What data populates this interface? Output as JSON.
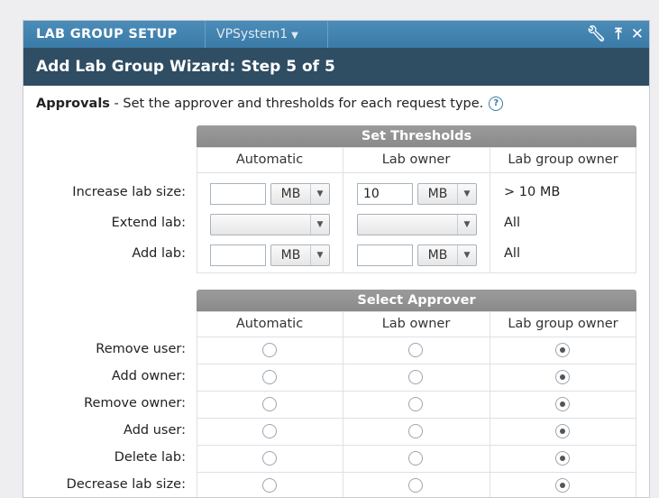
{
  "tabs": {
    "active": "LAB GROUP SETUP",
    "system": "VPSystem1"
  },
  "wizard": {
    "title": "Add Lab Group Wizard: Step 5 of 5"
  },
  "approvals": {
    "label": "Approvals",
    "text": " - Set the approver and thresholds for each request type."
  },
  "thresholds": {
    "title": "Set Thresholds",
    "columns": [
      "Automatic",
      "Lab owner",
      "Lab group owner"
    ],
    "rows": [
      {
        "label": "Increase lab size:",
        "auto_value": "",
        "auto_unit": "MB",
        "owner_value": "10",
        "owner_unit": "MB",
        "group": "> 10 MB"
      },
      {
        "label": "Extend lab:",
        "auto_value": "",
        "auto_unit": "",
        "owner_value": "",
        "owner_unit": "",
        "group": "All"
      },
      {
        "label": "Add lab:",
        "auto_value": "",
        "auto_unit": "MB",
        "owner_value": "",
        "owner_unit": "MB",
        "group": "All"
      }
    ]
  },
  "approver": {
    "title": "Select Approver",
    "columns": [
      "Automatic",
      "Lab owner",
      "Lab group owner"
    ],
    "rows": [
      {
        "label": "Remove user:",
        "selected": 2
      },
      {
        "label": "Add owner:",
        "selected": 2
      },
      {
        "label": "Remove owner:",
        "selected": 2
      },
      {
        "label": "Add user:",
        "selected": 2
      },
      {
        "label": "Delete lab:",
        "selected": 2
      },
      {
        "label": "Decrease lab size:",
        "selected": 2
      }
    ]
  }
}
